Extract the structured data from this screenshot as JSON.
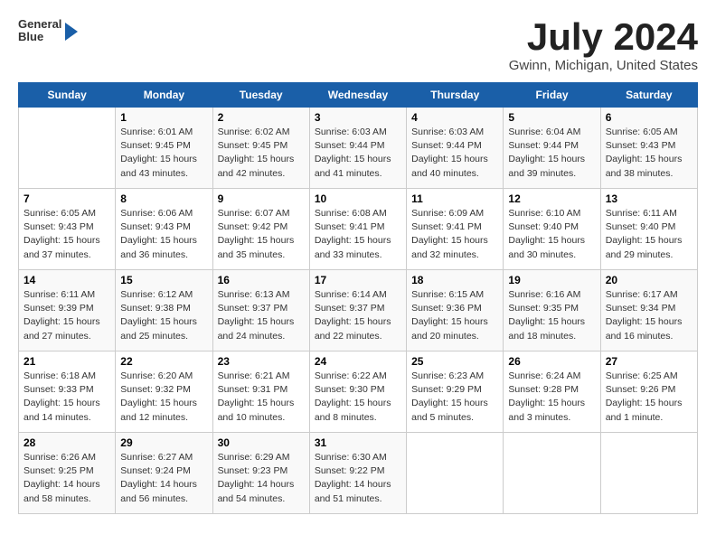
{
  "header": {
    "logo_line1": "General",
    "logo_line2": "Blue",
    "month_title": "July 2024",
    "location": "Gwinn, Michigan, United States"
  },
  "weekdays": [
    "Sunday",
    "Monday",
    "Tuesday",
    "Wednesday",
    "Thursday",
    "Friday",
    "Saturday"
  ],
  "weeks": [
    [
      {
        "day": "",
        "info": ""
      },
      {
        "day": "1",
        "info": "Sunrise: 6:01 AM\nSunset: 9:45 PM\nDaylight: 15 hours\nand 43 minutes."
      },
      {
        "day": "2",
        "info": "Sunrise: 6:02 AM\nSunset: 9:45 PM\nDaylight: 15 hours\nand 42 minutes."
      },
      {
        "day": "3",
        "info": "Sunrise: 6:03 AM\nSunset: 9:44 PM\nDaylight: 15 hours\nand 41 minutes."
      },
      {
        "day": "4",
        "info": "Sunrise: 6:03 AM\nSunset: 9:44 PM\nDaylight: 15 hours\nand 40 minutes."
      },
      {
        "day": "5",
        "info": "Sunrise: 6:04 AM\nSunset: 9:44 PM\nDaylight: 15 hours\nand 39 minutes."
      },
      {
        "day": "6",
        "info": "Sunrise: 6:05 AM\nSunset: 9:43 PM\nDaylight: 15 hours\nand 38 minutes."
      }
    ],
    [
      {
        "day": "7",
        "info": "Sunrise: 6:05 AM\nSunset: 9:43 PM\nDaylight: 15 hours\nand 37 minutes."
      },
      {
        "day": "8",
        "info": "Sunrise: 6:06 AM\nSunset: 9:43 PM\nDaylight: 15 hours\nand 36 minutes."
      },
      {
        "day": "9",
        "info": "Sunrise: 6:07 AM\nSunset: 9:42 PM\nDaylight: 15 hours\nand 35 minutes."
      },
      {
        "day": "10",
        "info": "Sunrise: 6:08 AM\nSunset: 9:41 PM\nDaylight: 15 hours\nand 33 minutes."
      },
      {
        "day": "11",
        "info": "Sunrise: 6:09 AM\nSunset: 9:41 PM\nDaylight: 15 hours\nand 32 minutes."
      },
      {
        "day": "12",
        "info": "Sunrise: 6:10 AM\nSunset: 9:40 PM\nDaylight: 15 hours\nand 30 minutes."
      },
      {
        "day": "13",
        "info": "Sunrise: 6:11 AM\nSunset: 9:40 PM\nDaylight: 15 hours\nand 29 minutes."
      }
    ],
    [
      {
        "day": "14",
        "info": "Sunrise: 6:11 AM\nSunset: 9:39 PM\nDaylight: 15 hours\nand 27 minutes."
      },
      {
        "day": "15",
        "info": "Sunrise: 6:12 AM\nSunset: 9:38 PM\nDaylight: 15 hours\nand 25 minutes."
      },
      {
        "day": "16",
        "info": "Sunrise: 6:13 AM\nSunset: 9:37 PM\nDaylight: 15 hours\nand 24 minutes."
      },
      {
        "day": "17",
        "info": "Sunrise: 6:14 AM\nSunset: 9:37 PM\nDaylight: 15 hours\nand 22 minutes."
      },
      {
        "day": "18",
        "info": "Sunrise: 6:15 AM\nSunset: 9:36 PM\nDaylight: 15 hours\nand 20 minutes."
      },
      {
        "day": "19",
        "info": "Sunrise: 6:16 AM\nSunset: 9:35 PM\nDaylight: 15 hours\nand 18 minutes."
      },
      {
        "day": "20",
        "info": "Sunrise: 6:17 AM\nSunset: 9:34 PM\nDaylight: 15 hours\nand 16 minutes."
      }
    ],
    [
      {
        "day": "21",
        "info": "Sunrise: 6:18 AM\nSunset: 9:33 PM\nDaylight: 15 hours\nand 14 minutes."
      },
      {
        "day": "22",
        "info": "Sunrise: 6:20 AM\nSunset: 9:32 PM\nDaylight: 15 hours\nand 12 minutes."
      },
      {
        "day": "23",
        "info": "Sunrise: 6:21 AM\nSunset: 9:31 PM\nDaylight: 15 hours\nand 10 minutes."
      },
      {
        "day": "24",
        "info": "Sunrise: 6:22 AM\nSunset: 9:30 PM\nDaylight: 15 hours\nand 8 minutes."
      },
      {
        "day": "25",
        "info": "Sunrise: 6:23 AM\nSunset: 9:29 PM\nDaylight: 15 hours\nand 5 minutes."
      },
      {
        "day": "26",
        "info": "Sunrise: 6:24 AM\nSunset: 9:28 PM\nDaylight: 15 hours\nand 3 minutes."
      },
      {
        "day": "27",
        "info": "Sunrise: 6:25 AM\nSunset: 9:26 PM\nDaylight: 15 hours\nand 1 minute."
      }
    ],
    [
      {
        "day": "28",
        "info": "Sunrise: 6:26 AM\nSunset: 9:25 PM\nDaylight: 14 hours\nand 58 minutes."
      },
      {
        "day": "29",
        "info": "Sunrise: 6:27 AM\nSunset: 9:24 PM\nDaylight: 14 hours\nand 56 minutes."
      },
      {
        "day": "30",
        "info": "Sunrise: 6:29 AM\nSunset: 9:23 PM\nDaylight: 14 hours\nand 54 minutes."
      },
      {
        "day": "31",
        "info": "Sunrise: 6:30 AM\nSunset: 9:22 PM\nDaylight: 14 hours\nand 51 minutes."
      },
      {
        "day": "",
        "info": ""
      },
      {
        "day": "",
        "info": ""
      },
      {
        "day": "",
        "info": ""
      }
    ]
  ]
}
